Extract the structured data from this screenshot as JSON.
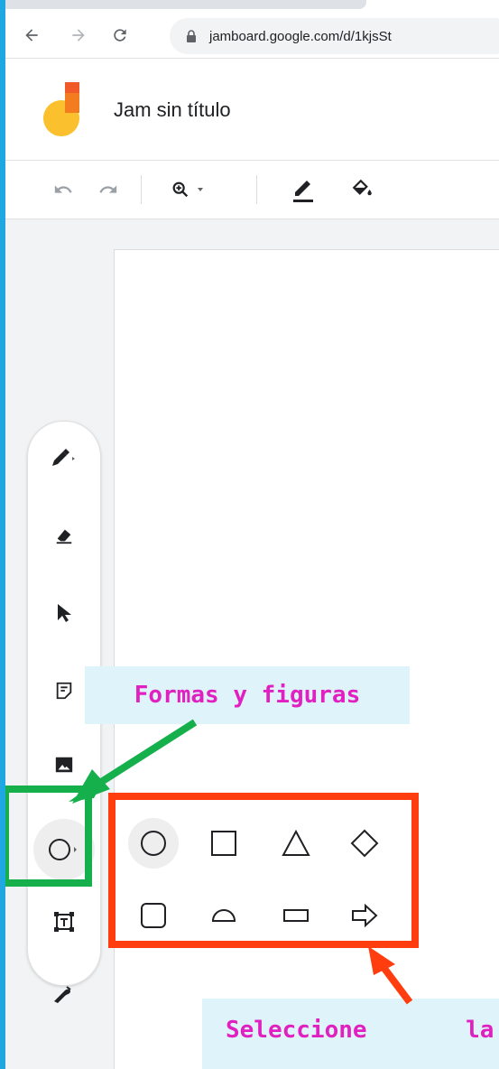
{
  "browser": {
    "url": "jamboard.google.com/d/1kjsSt"
  },
  "app": {
    "title": "Jam sin título"
  },
  "annotations": {
    "shapes_callout": "Formas y figuras",
    "select_callout": "Seleccione       la"
  },
  "colors": {
    "green_highlight": "#15b04b",
    "red_highlight": "#ff3d0e",
    "callout_text": "#e020c0",
    "callout_bg": "#dff3fb"
  }
}
